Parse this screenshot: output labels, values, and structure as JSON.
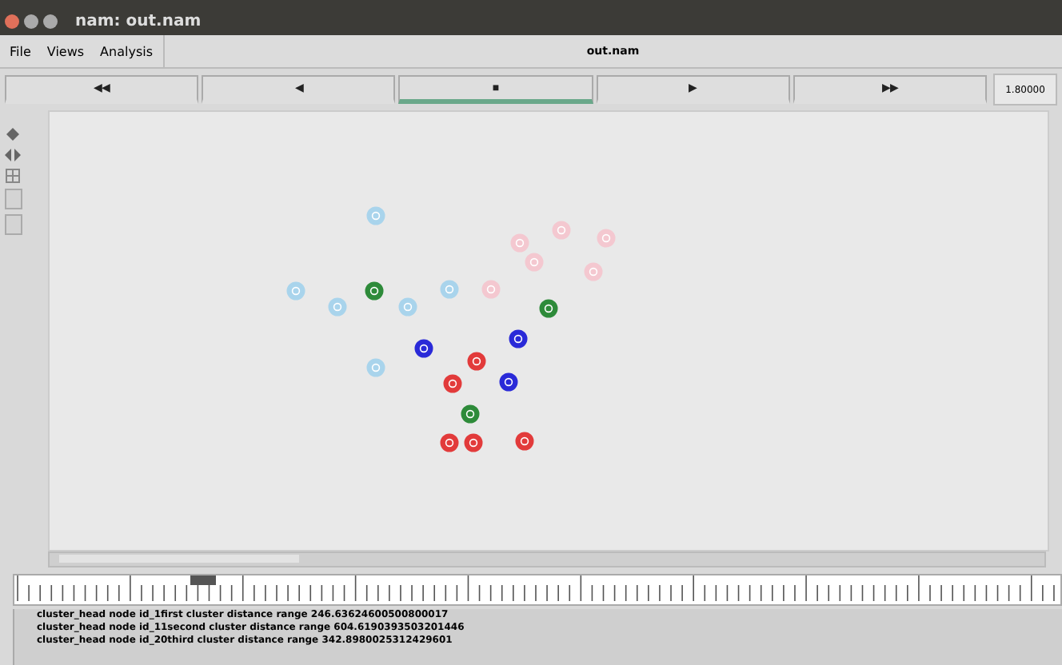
{
  "window": {
    "title": "nam: out.nam"
  },
  "menu": [
    {
      "label": "File"
    },
    {
      "label": "Views"
    },
    {
      "label": "Analysis"
    }
  ],
  "file_label": "out.nam",
  "controls": [
    {
      "label": "◀◀",
      "selected": false
    },
    {
      "label": "◀",
      "selected": false
    },
    {
      "label": "■",
      "selected": true
    },
    {
      "label": "▶",
      "selected": false
    },
    {
      "label": "▶▶",
      "selected": false
    }
  ],
  "time": "1.80000",
  "nodes": [
    {
      "color": "#a9d4ec"
    },
    {
      "color": "#a9d4ec"
    },
    {
      "color": "#a9d4ec"
    },
    {
      "color": "#a9d4ec"
    },
    {
      "color": "#a9d4ec"
    },
    {
      "color": "#a9d4ec"
    },
    {
      "color": "#2e8b3a"
    },
    {
      "color": "#2e8b3a"
    },
    {
      "color": "#2e8b3a"
    },
    {
      "color": "#f4c8d0"
    },
    {
      "color": "#f4c8d0"
    },
    {
      "color": "#f4c8d0"
    },
    {
      "color": "#f4c8d0"
    },
    {
      "color": "#f4c8d0"
    },
    {
      "color": "#f4c8d0"
    },
    {
      "color": "#2a2ad8"
    },
    {
      "color": "#2a2ad8"
    },
    {
      "color": "#2a2ad8"
    },
    {
      "color": "#e23b3b"
    },
    {
      "color": "#e23b3b"
    },
    {
      "color": "#e23b3b"
    },
    {
      "color": "#e23b3b"
    },
    {
      "color": "#e23b3b"
    }
  ],
  "status_lines": [
    "cluster_head node id_1first cluster distance range 246.63624600500800017",
    "cluster_head node id_11second cluster distance range 604.6190393503201446",
    "cluster_head node id_20third cluster distance range 342.8980025312429601"
  ]
}
